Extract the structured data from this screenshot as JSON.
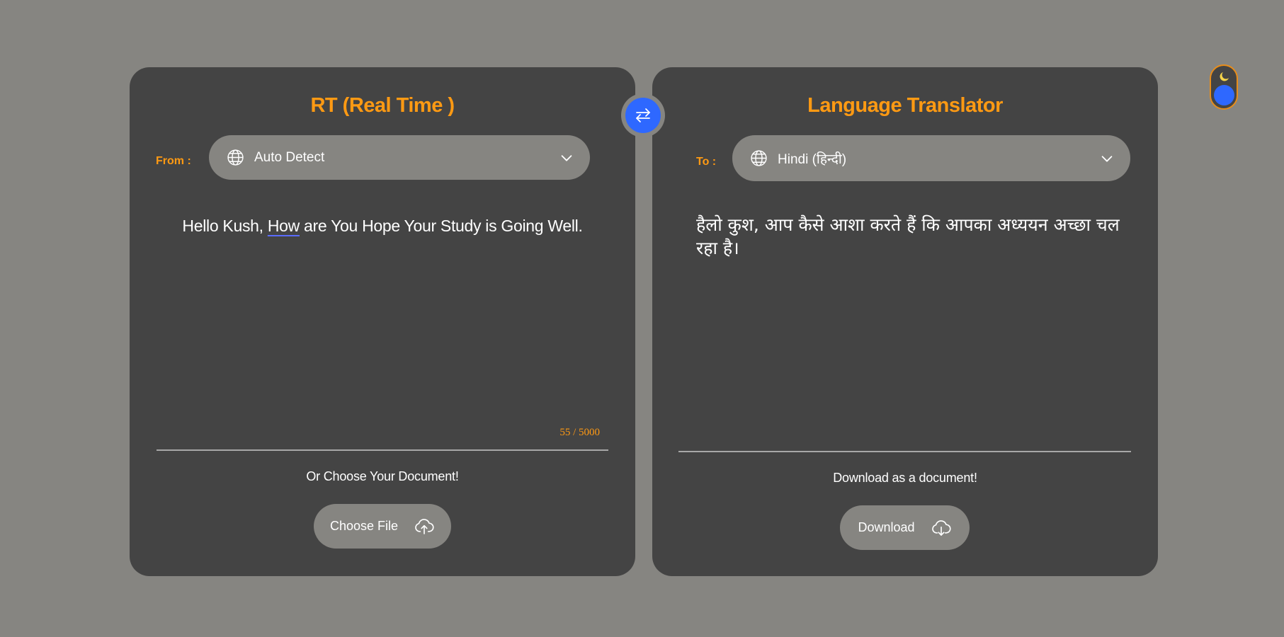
{
  "source_panel": {
    "title": "RT (Real Time )",
    "from_label": "From :",
    "language": {
      "icon": "globe-icon",
      "value": "Auto Detect",
      "dropdown_icon": "chevron-down-icon"
    },
    "text_parts": [
      "Hello Kush, ",
      "How",
      " are You Hope Your Study is Going Well."
    ],
    "char_count": "55 / 5000",
    "upload_caption": "Or Choose Your Document!",
    "upload_button": {
      "label": "Choose File",
      "icon": "cloud-upload-icon"
    }
  },
  "target_panel": {
    "title": "Language Translator",
    "to_label": "To :",
    "language": {
      "icon": "globe-icon",
      "value": "Hindi (हिन्दी)",
      "dropdown_icon": "chevron-down-icon"
    },
    "translated_text": "हैलो कुश, आप कैसे आशा करते हैं कि आपका अध्ययन अच्छा चल रहा है।",
    "download_caption": "Download as a document!",
    "download_button": {
      "label": "Download",
      "icon": "cloud-download-icon"
    }
  },
  "swap_button": {
    "icon": "swap-arrows-icon"
  },
  "theme_toggle": {
    "icon": "moon-icon",
    "state": "dark"
  },
  "colors": {
    "background": "#868581",
    "card": "#444444",
    "accent": "#ff9a13",
    "primary_blue": "#2e68ff",
    "text": "#ffffff"
  }
}
